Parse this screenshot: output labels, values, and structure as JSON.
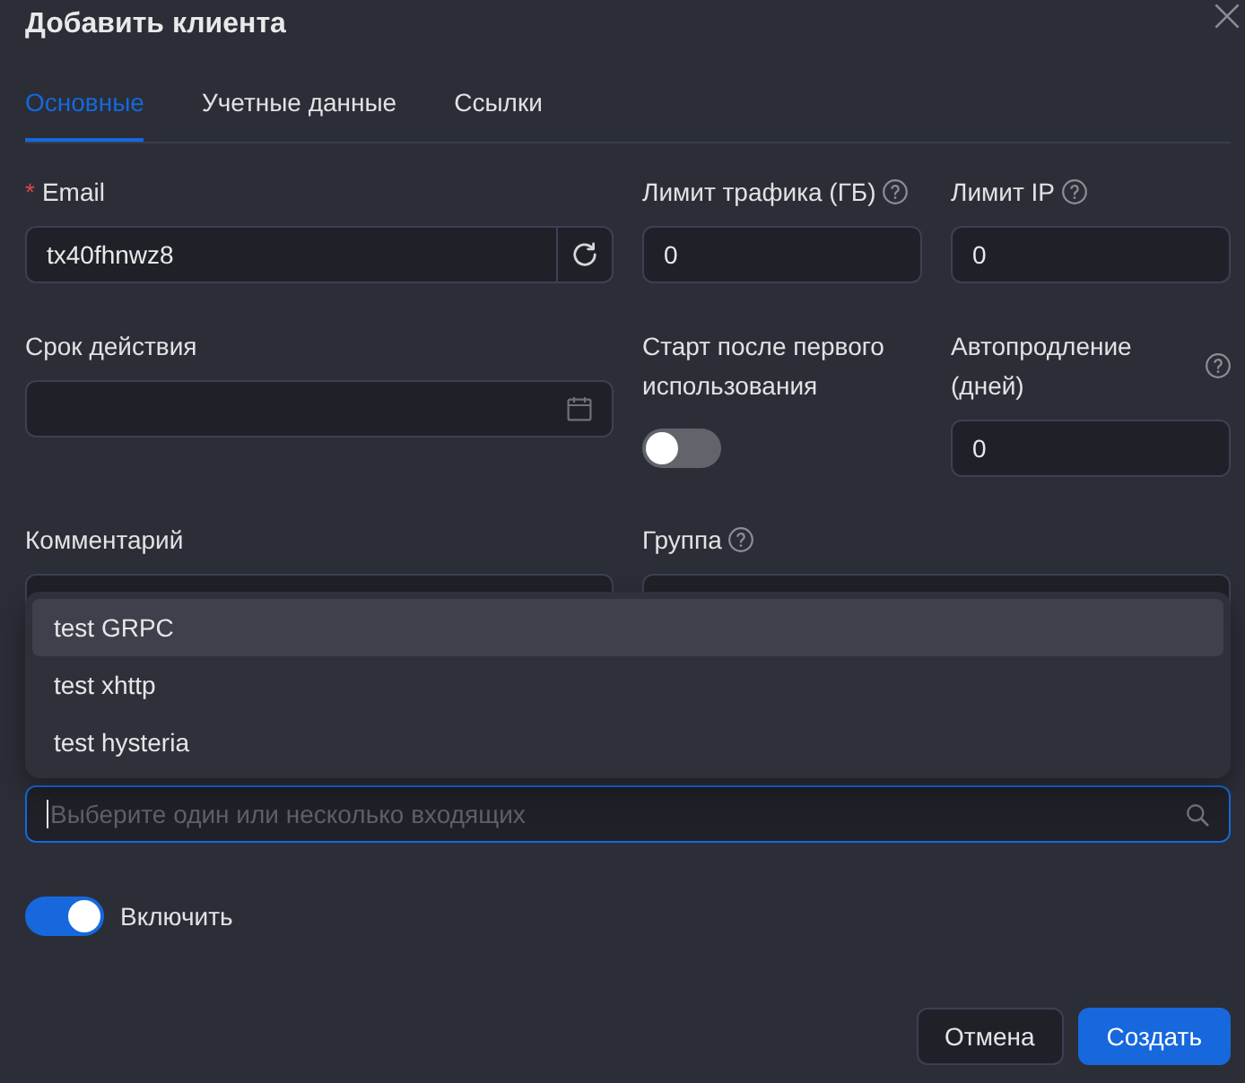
{
  "dialog": {
    "title": "Добавить клиента"
  },
  "tabs": [
    {
      "label": "Основные",
      "selected": true
    },
    {
      "label": "Учетные данные",
      "selected": false
    },
    {
      "label": "Ссылки",
      "selected": false
    }
  ],
  "form_rows": [
    [
      {
        "kind": "text-refresh",
        "label": "Email",
        "required_mark": "*",
        "help": false,
        "value": "tx40fhnwz8"
      },
      {
        "kind": "number",
        "label": "Лимит трафика (ГБ)",
        "help": true,
        "value": "0"
      },
      {
        "kind": "number",
        "label": "Лимит IP",
        "help": true,
        "value": "0"
      }
    ],
    [
      {
        "kind": "date",
        "label": "Срок действия",
        "help": false
      },
      {
        "kind": "switch",
        "label": "Старт после первого использования",
        "help": false,
        "on": false
      },
      {
        "kind": "number",
        "label": "Автопродление (дней)",
        "help": true,
        "value": "0"
      }
    ],
    [
      {
        "kind": "text",
        "label": "Комментарий",
        "help": false
      },
      {
        "kind": "text",
        "label": "Группа",
        "help": true
      }
    ]
  ],
  "inbounds": {
    "placeholder": "Выберите один или несколько входящих",
    "focused": true,
    "open": true,
    "options": [
      {
        "label": "test GRPC",
        "active": true,
        "selected": false
      },
      {
        "label": "test xhttp",
        "active": false,
        "selected": false
      },
      {
        "label": "test hysteria",
        "active": false,
        "selected": false
      }
    ]
  },
  "enable": {
    "label": "Включить",
    "on": true
  },
  "buttons": [
    {
      "label": "Отмена",
      "kind": "default"
    },
    {
      "label": "Создать",
      "kind": "primary"
    }
  ]
}
